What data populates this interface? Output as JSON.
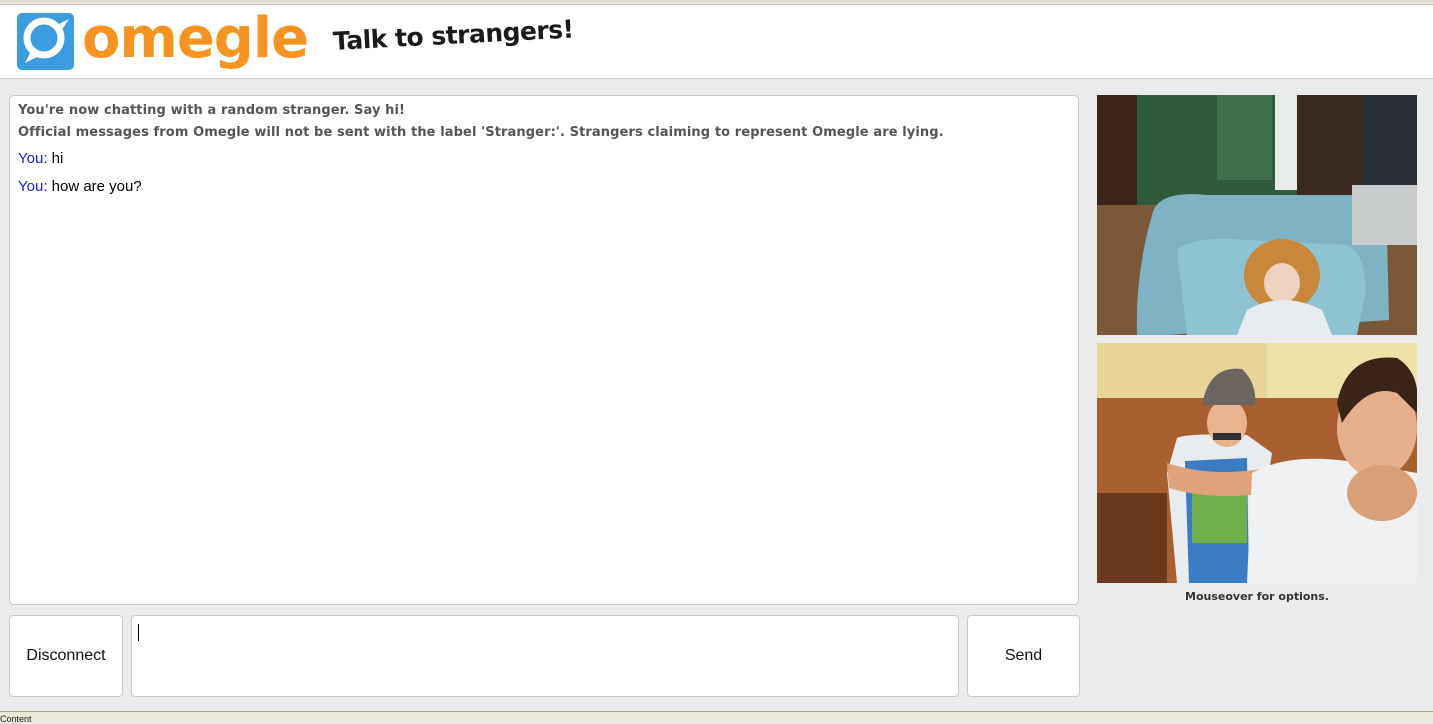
{
  "header": {
    "logo_text": "omegle",
    "tagline": "Talk to strangers!"
  },
  "chat": {
    "system_messages": [
      "You're now chatting with a random stranger. Say hi!",
      "Official messages from Omegle will not be sent with the label 'Stranger:'. Strangers claiming to represent Omegle are lying."
    ],
    "messages": [
      {
        "sender": "You:",
        "text": " hi"
      },
      {
        "sender": "You:",
        "text": " how are you?"
      }
    ]
  },
  "controls": {
    "disconnect_label": "Disconnect",
    "send_label": "Send",
    "message_value": ""
  },
  "video": {
    "hint": "Mouseover for options."
  },
  "status_bar": {
    "text": "Content"
  },
  "colors": {
    "brand_orange": "#f7931e",
    "brand_blue": "#3b9de0",
    "you_label": "#1e23c8"
  },
  "icons": {
    "logo": "omegle-speech-bubble-icon"
  }
}
